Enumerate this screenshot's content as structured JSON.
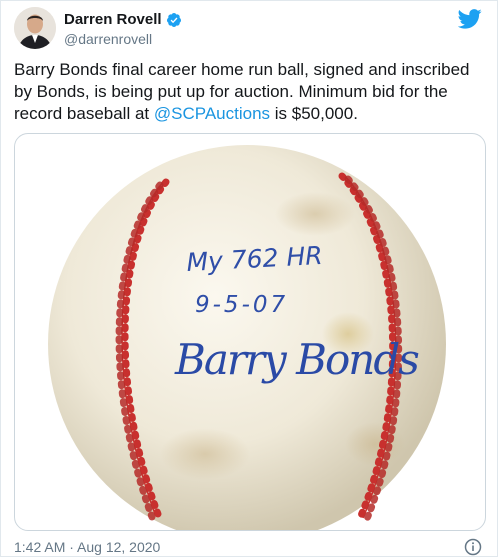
{
  "author": {
    "name": "Darren Rovell",
    "handle": "@darrenrovell"
  },
  "tweet": {
    "text_before": "Barry Bonds final career home run ball, signed and inscribed by Bonds, is being put up for auction. Minimum bid for the record baseball at ",
    "mention": "@SCPAuctions",
    "text_after": " is $50,000."
  },
  "media": {
    "inscription_line1": "My 762 HR",
    "inscription_line2": "9-5-07",
    "signature": "Barry Bonds"
  },
  "footer": {
    "timestamp": "1:42 AM · Aug 12, 2020"
  },
  "icons": {
    "verified": "verified-badge-icon",
    "bird": "twitter-bird-icon",
    "info": "info-icon"
  },
  "colors": {
    "accent": "#1da1f2",
    "link": "#1b95e0",
    "muted": "#657786",
    "stitch": "#c8302e"
  }
}
